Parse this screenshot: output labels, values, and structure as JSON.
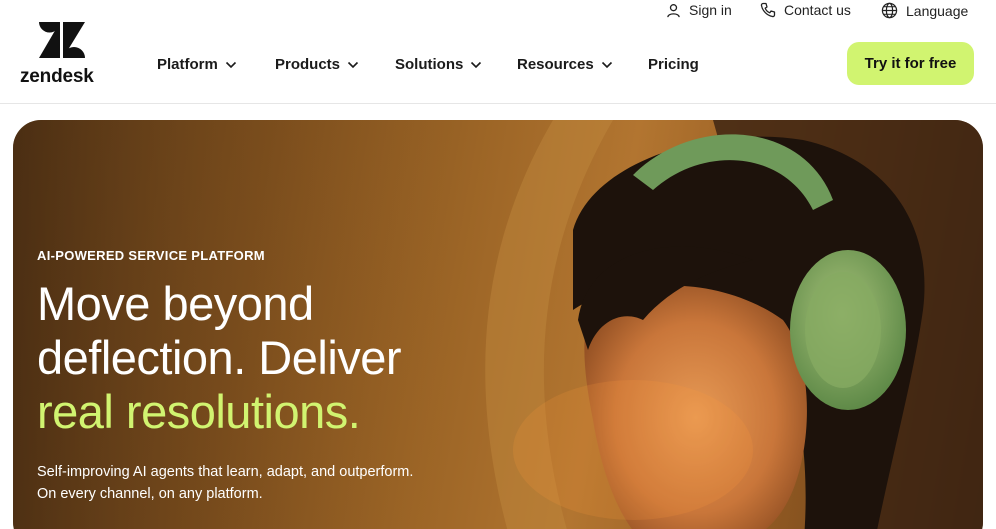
{
  "brand": {
    "name": "zendesk"
  },
  "utility": {
    "sign_in": "Sign in",
    "contact_us": "Contact us",
    "language": "Language"
  },
  "nav": {
    "items": [
      {
        "label": "Platform",
        "has_menu": true
      },
      {
        "label": "Products",
        "has_menu": true
      },
      {
        "label": "Solutions",
        "has_menu": true
      },
      {
        "label": "Resources",
        "has_menu": true
      },
      {
        "label": "Pricing",
        "has_menu": false
      }
    ],
    "cta": "Try it for free"
  },
  "hero": {
    "eyebrow": "AI-POWERED SERVICE PLATFORM",
    "headline_line1": "Move beyond",
    "headline_line2": "deflection. Deliver",
    "headline_accent": "real resolutions.",
    "sub_line1": "Self-improving AI agents that learn, adapt, and outperform.",
    "sub_line2": "On every channel, on any platform."
  },
  "colors": {
    "accent": "#d1f470",
    "hero_brown": "#8a5a22",
    "headphones": "#6f9a5a"
  }
}
